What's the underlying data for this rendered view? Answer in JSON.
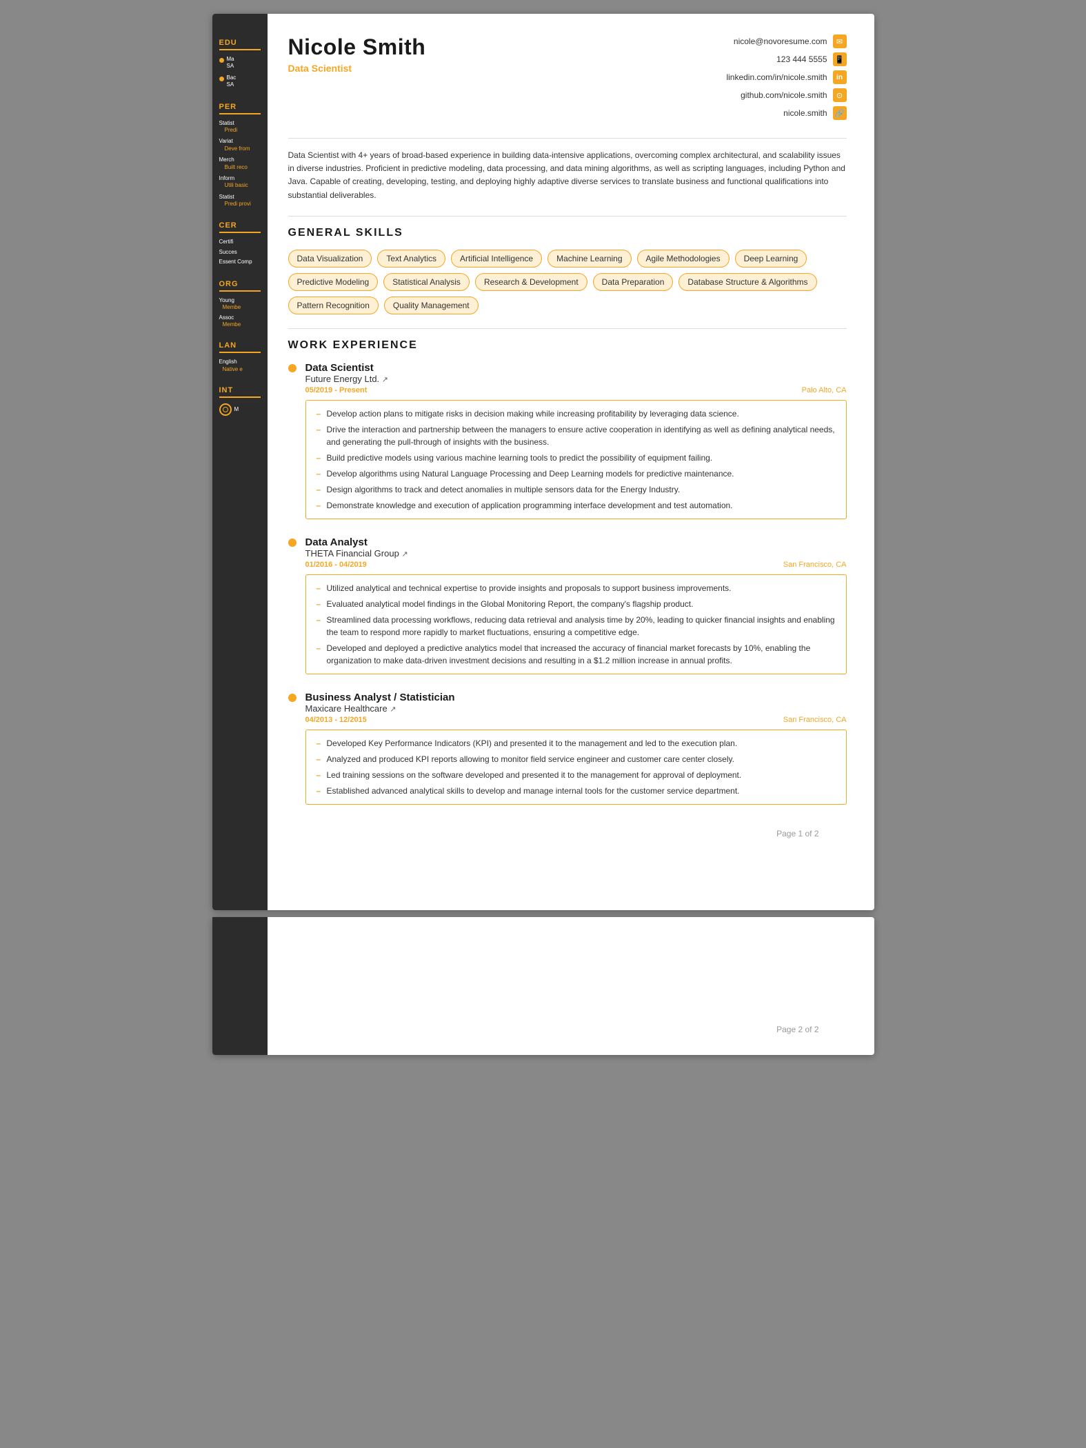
{
  "page": {
    "number": "Page 1 of 2",
    "number2": "Page 2 of 2"
  },
  "header": {
    "name": "Nicole Smith",
    "title": "Data Scientist",
    "contact": {
      "email": "nicole@novoresume.com",
      "phone": "123 444 5555",
      "linkedin": "linkedin.com/in/nicole.smith",
      "github": "github.com/nicole.smith",
      "website": "nicole.smith"
    }
  },
  "summary": "Data Scientist with 4+ years of broad-based experience in building data-intensive applications, overcoming complex architectural, and scalability issues in diverse industries. Proficient in predictive modeling, data processing, and data mining algorithms, as well as scripting languages, including Python and Java. Capable of creating, developing, testing, and deploying highly adaptive diverse services to translate business and functional qualifications into substantial deliverables.",
  "skills_heading": "GENERAL SKILLS",
  "skills": [
    "Data Visualization",
    "Text Analytics",
    "Artificial Intelligence",
    "Machine Learning",
    "Agile Methodologies",
    "Deep Learning",
    "Predictive Modeling",
    "Statistical Analysis",
    "Research & Development",
    "Data Preparation",
    "Database Structure & Algorithms",
    "Pattern Recognition",
    "Quality Management"
  ],
  "work_heading": "WORK EXPERIENCE",
  "work": [
    {
      "title": "Data Scientist",
      "company": "Future Energy Ltd.",
      "dates": "05/2019 - Present",
      "location": "Palo Alto, CA",
      "bullets": [
        "Develop action plans to mitigate risks in decision making while increasing profitability by leveraging data science.",
        "Drive the interaction and partnership between the managers to ensure active cooperation in identifying as well as defining analytical needs, and generating the pull-through of insights with the business.",
        "Build predictive models using various machine learning tools to predict the possibility of equipment failing.",
        "Develop algorithms using Natural Language Processing and Deep Learning models for predictive maintenance.",
        "Design algorithms to track and detect anomalies in multiple sensors data for the Energy Industry.",
        "Demonstrate knowledge and execution of application programming interface development and test automation."
      ]
    },
    {
      "title": "Data Analyst",
      "company": "THETA Financial Group",
      "dates": "01/2016 - 04/2019",
      "location": "San Francisco, CA",
      "bullets": [
        "Utilized analytical and technical expertise to provide insights and proposals to support business improvements.",
        "Evaluated analytical model findings in the Global Monitoring Report, the company's flagship product.",
        "Streamlined data processing workflows, reducing data retrieval and analysis time by 20%, leading to quicker financial insights and enabling the team to respond more rapidly to market fluctuations, ensuring a competitive edge.",
        "Developed and deployed a predictive analytics model that increased the accuracy of financial market forecasts by 10%, enabling the organization to make data-driven investment decisions and resulting in a $1.2 million increase in annual profits."
      ]
    },
    {
      "title": "Business Analyst / Statistician",
      "company": "Maxicare Healthcare",
      "dates": "04/2013 - 12/2015",
      "location": "San Francisco, CA",
      "bullets": [
        "Developed Key Performance Indicators (KPI) and presented it to the management and led to the execution plan.",
        "Analyzed and produced KPI reports allowing to monitor field service engineer and customer care center closely.",
        "Led training sessions on the software developed and presented it to the management for approval of deployment.",
        "Established advanced analytical skills to develop and manage internal tools for the customer service department."
      ]
    }
  ],
  "sidebar": {
    "edu_label": "EDU",
    "edu_items": [
      {
        "degree": "Ma",
        "school": "SA"
      },
      {
        "degree": "Bac",
        "school": "SA"
      }
    ],
    "per_label": "PER",
    "per_items": [
      {
        "name": "Statist",
        "sub": "Predi"
      },
      {
        "name": "Variat",
        "sub": "Deve from"
      },
      {
        "name": "Merch",
        "sub": "Built reco"
      },
      {
        "name": "Inform",
        "sub": "Utili basic"
      },
      {
        "name": "Statist",
        "sub": "Predi provi"
      }
    ],
    "cer_label": "CER",
    "cer_items": [
      "Certifi",
      "Succes",
      "Essent Comp"
    ],
    "org_label": "ORG",
    "org_items": [
      {
        "name": "Young",
        "sub": "Membe"
      },
      {
        "name": "Assoc",
        "sub": "Membe"
      }
    ],
    "lan_label": "LAN",
    "lan_items": [
      {
        "name": "English",
        "sub": "Native e"
      }
    ],
    "int_label": "INT",
    "int_items": [
      "M"
    ]
  }
}
